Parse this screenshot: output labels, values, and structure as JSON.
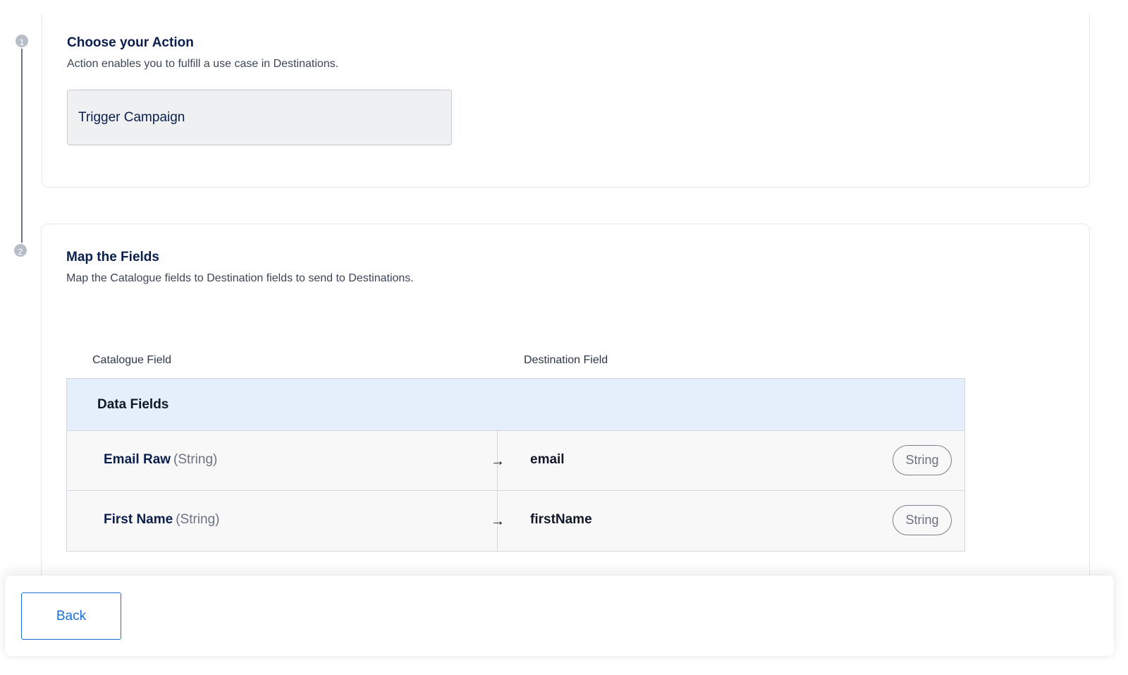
{
  "steps": [
    {
      "number": "1",
      "title": "Choose your Action",
      "description": "Action enables you to fulfill a use case in Destinations.",
      "selected_action": "Trigger Campaign"
    },
    {
      "number": "2",
      "title": "Map the Fields",
      "description": "Map the Catalogue fields to Destination fields to send to Destinations."
    }
  ],
  "mapping": {
    "catalogue_header": "Catalogue Field",
    "destination_header": "Destination Field",
    "group_label": "Data Fields",
    "rows": [
      {
        "source_name": "Email Raw",
        "source_type": "(String)",
        "arrow": "→",
        "destination_name": "email",
        "destination_type": "String"
      },
      {
        "source_name": "First Name",
        "source_type": "(String)",
        "arrow": "→",
        "destination_name": "firstName",
        "destination_type": "String"
      }
    ]
  },
  "footer": {
    "back_label": "Back"
  },
  "colors": {
    "accent": "#1a6fd6",
    "title": "#0b1f4d",
    "group_bg": "#e5effc",
    "step_dot": "#b8bec8"
  }
}
